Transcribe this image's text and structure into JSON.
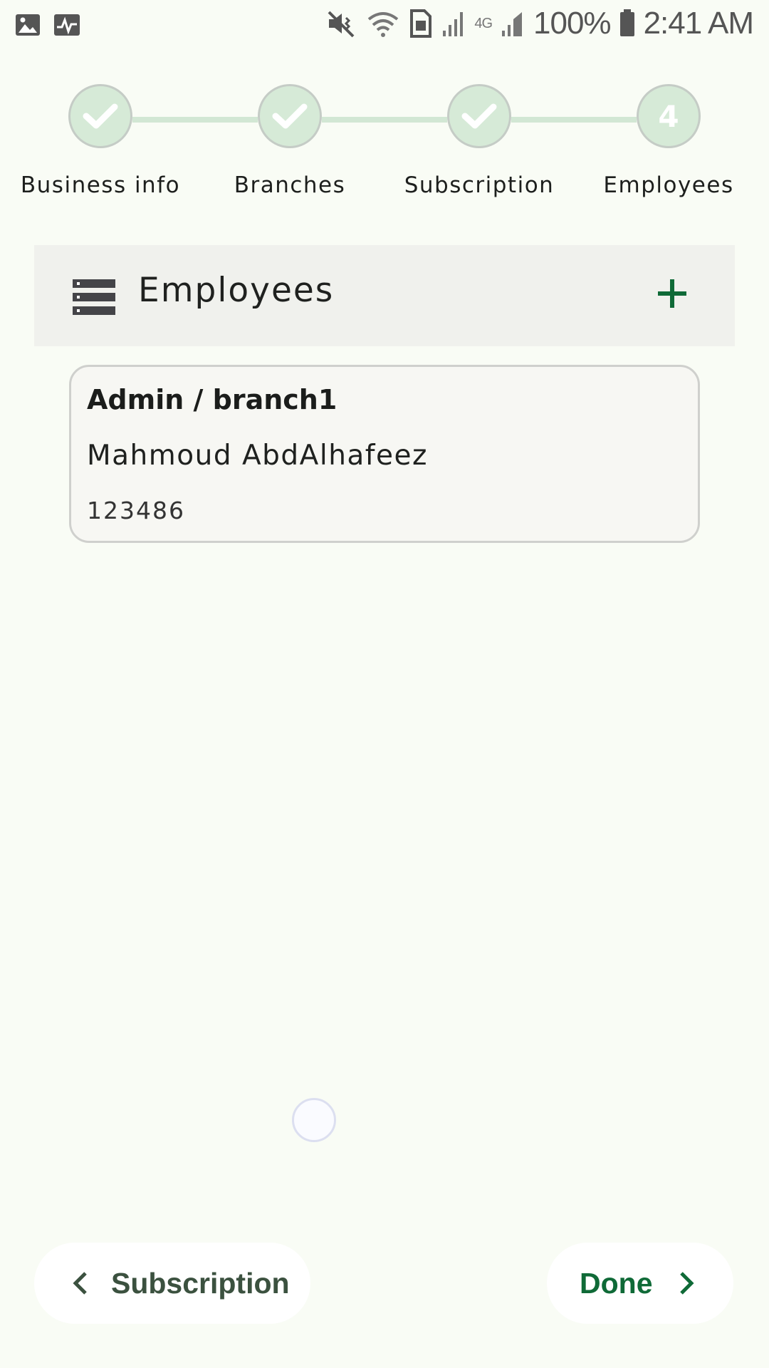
{
  "status_bar": {
    "battery_percent": "100%",
    "time": "2:41 AM",
    "network": "4G",
    "icons": [
      "gallery-icon",
      "activity-icon",
      "mute-icon",
      "wifi-icon",
      "sim-icon",
      "signal-icon",
      "signal-icon",
      "battery-icon"
    ]
  },
  "stepper": {
    "steps": [
      {
        "label": "Business info",
        "state": "completed"
      },
      {
        "label": "Branches",
        "state": "completed"
      },
      {
        "label": "Subscription",
        "state": "completed"
      },
      {
        "label": "Employees",
        "state": "current",
        "number": "4"
      }
    ],
    "colors": {
      "circle": "#d6ead7",
      "line": "#d2e7d4"
    }
  },
  "section": {
    "title": "Employees",
    "icons": [
      "list-icon",
      "plus-icon"
    ]
  },
  "employees": [
    {
      "role_branch": "Admin / branch1",
      "name": "Mahmoud AbdAlhafeez",
      "code": "123486"
    }
  ],
  "nav": {
    "back_label": "Subscription",
    "next_label": "Done"
  },
  "colors": {
    "accent": "#0f6a37",
    "background": "#f9fcf5"
  }
}
